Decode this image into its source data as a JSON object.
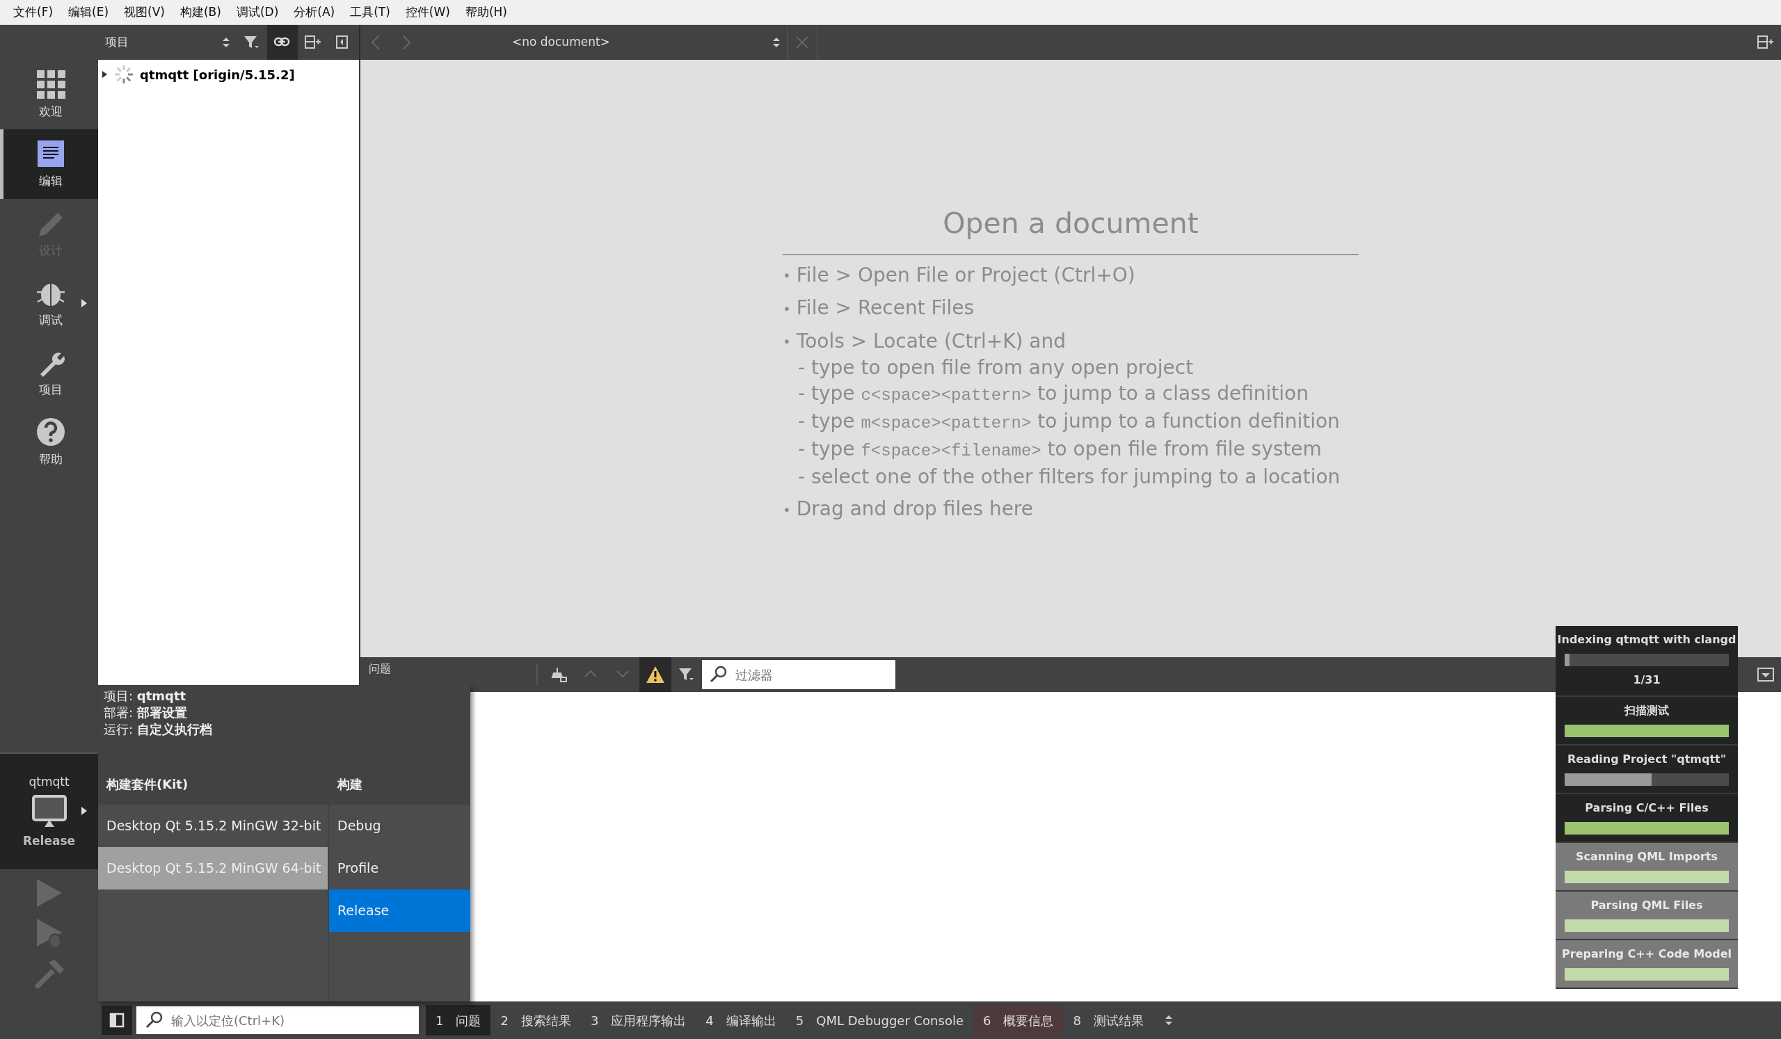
{
  "menu": [
    "文件(F)",
    "编辑(E)",
    "视图(V)",
    "构建(B)",
    "调试(D)",
    "分析(A)",
    "工具(T)",
    "控件(W)",
    "帮助(H)"
  ],
  "toolbar": {
    "view_selector": "项目",
    "document_selector": "<no document>"
  },
  "mode_bar": [
    {
      "kind": "welcome",
      "label": "欢迎",
      "selected": false,
      "disabled": false
    },
    {
      "kind": "edit",
      "label": "编辑",
      "selected": true,
      "disabled": false
    },
    {
      "kind": "design",
      "label": "设计",
      "selected": false,
      "disabled": true
    },
    {
      "kind": "debug",
      "label": "调试",
      "selected": false,
      "disabled": false
    },
    {
      "kind": "projects",
      "label": "项目",
      "selected": false,
      "disabled": false
    },
    {
      "kind": "help",
      "label": "帮助",
      "selected": false,
      "disabled": false
    }
  ],
  "kit_selector": {
    "project": "qtmqtt",
    "build": "Release"
  },
  "project_tree": [
    {
      "label": "qtmqtt [origin/5.15.2]",
      "expanded": false
    }
  ],
  "welcome": {
    "title": "Open a document",
    "lines": [
      {
        "kind": "bullet",
        "marker": "•",
        "parts": [
          {
            "kind": "text",
            "text": "File > Open File or Project (Ctrl+O)"
          }
        ]
      },
      {
        "kind": "bullet",
        "marker": "•",
        "parts": [
          {
            "kind": "text",
            "text": "File > Recent Files"
          }
        ]
      },
      {
        "kind": "bullet",
        "marker": "•",
        "parts": [
          {
            "kind": "text",
            "text": "Tools > Locate (Ctrl+K) and"
          }
        ]
      },
      {
        "kind": "sub",
        "parts": [
          {
            "kind": "text",
            "text": "- type to open file from any open project"
          }
        ]
      },
      {
        "kind": "sub",
        "parts": [
          {
            "kind": "text",
            "text": "- type "
          },
          {
            "kind": "code",
            "text": "c<space><pattern>"
          },
          {
            "kind": "text",
            "text": " to jump to a class definition"
          }
        ]
      },
      {
        "kind": "sub",
        "parts": [
          {
            "kind": "text",
            "text": "- type "
          },
          {
            "kind": "code",
            "text": "m<space><pattern>"
          },
          {
            "kind": "text",
            "text": " to jump to a function definition"
          }
        ]
      },
      {
        "kind": "sub",
        "parts": [
          {
            "kind": "text",
            "text": "- type "
          },
          {
            "kind": "code",
            "text": "f<space><filename>"
          },
          {
            "kind": "text",
            "text": " to open file from file system"
          }
        ]
      },
      {
        "kind": "sub",
        "parts": [
          {
            "kind": "text",
            "text": "- select one of the other filters for jumping to a location"
          }
        ]
      },
      {
        "kind": "bullet",
        "marker": "•",
        "parts": [
          {
            "kind": "text",
            "text": "Drag and drop files here"
          }
        ]
      }
    ]
  },
  "output_pane": {
    "title": "问题",
    "warnings_on": true,
    "filter_placeholder": "过滤器"
  },
  "target_popup": {
    "info": [
      {
        "label": "项目:",
        "value": "qtmqtt"
      },
      {
        "label": "部署:",
        "value": "部署设置"
      },
      {
        "label": "运行:",
        "value": "自定义执行档"
      }
    ],
    "kit_header": "构建套件(Kit)",
    "build_header": "构建",
    "kits": [
      {
        "label": "Desktop Qt 5.15.2 MinGW 32-bit",
        "selected": false
      },
      {
        "label": "Desktop Qt 5.15.2 MinGW 64-bit",
        "selected": true
      }
    ],
    "builds": [
      {
        "label": "Debug",
        "selected": false
      },
      {
        "label": "Profile",
        "selected": false
      },
      {
        "label": "Release",
        "selected": true
      }
    ]
  },
  "progress": [
    {
      "title": "Indexing qtmqtt with clangd",
      "level": 0.03,
      "done": false,
      "faded": false,
      "detail": "1/31"
    },
    {
      "title": "扫描测试",
      "level": 1,
      "done": true,
      "faded": false
    },
    {
      "title": "Reading Project \"qtmqtt\"",
      "level": 0.53,
      "done": false,
      "faded": false
    },
    {
      "title": "Parsing C/C++ Files",
      "level": 1,
      "done": true,
      "faded": false
    },
    {
      "title": "Scanning QML Imports",
      "level": 1,
      "done": true,
      "faded": true
    },
    {
      "title": "Parsing QML Files",
      "level": 1,
      "done": true,
      "faded": true
    },
    {
      "title": "Preparing C++ Code Model",
      "level": 1,
      "done": true,
      "faded": true
    }
  ],
  "status_bar": {
    "locator_placeholder": "输入以定位(Ctrl+K)",
    "panes": [
      {
        "number": "1",
        "label": "问题",
        "selected": true,
        "flashing": false
      },
      {
        "number": "2",
        "label": "搜索结果",
        "selected": false,
        "flashing": false
      },
      {
        "number": "3",
        "label": "应用程序输出",
        "selected": false,
        "flashing": false
      },
      {
        "number": "4",
        "label": "编译输出",
        "selected": false,
        "flashing": false
      },
      {
        "number": "5",
        "label": "QML Debugger Console",
        "selected": false,
        "flashing": false
      },
      {
        "number": "6",
        "label": "概要信息",
        "selected": false,
        "flashing": true
      },
      {
        "number": "8",
        "label": "测试结果",
        "selected": false,
        "flashing": false
      }
    ]
  }
}
